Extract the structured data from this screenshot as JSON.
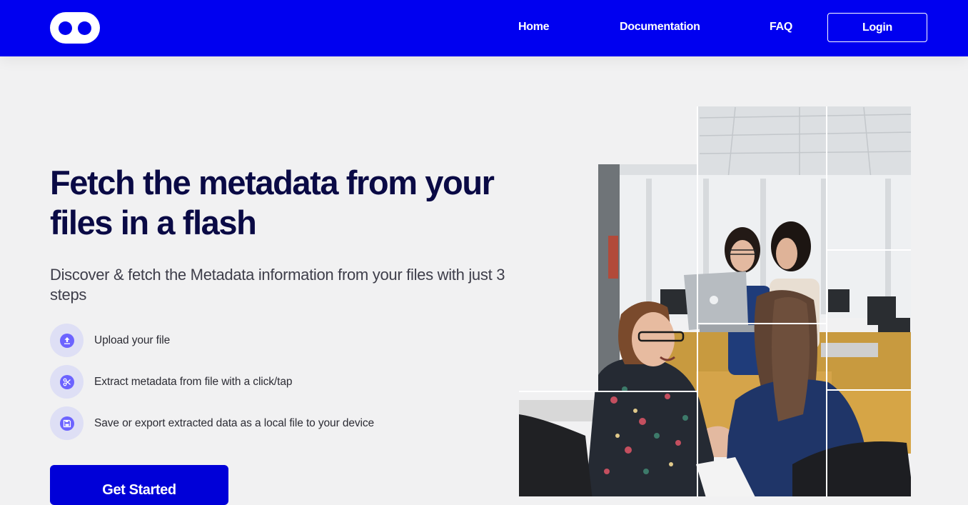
{
  "nav": {
    "logo_icon": "eyes-logo-icon",
    "links": [
      "Home",
      "Documentation",
      "FAQ"
    ],
    "login_label": "Login"
  },
  "hero": {
    "title": "Fetch the metadata from your files in a flash",
    "subtitle": "Discover & fetch the Metadata information from your files with just 3 steps",
    "steps": [
      {
        "icon": "upload-icon",
        "label": "Upload your file"
      },
      {
        "icon": "scissors-icon",
        "label": "Extract metadata from file with a click/tap"
      },
      {
        "icon": "save-icon",
        "label": "Save or export extracted data as a local file to your device"
      }
    ],
    "cta_label": "Get Started"
  },
  "image": {
    "name": "office-team-photo-collage"
  },
  "colors": {
    "brand_blue": "#0000f0",
    "title_navy": "#0a0a45",
    "icon_purple": "#6c63ff",
    "background": "#f1f1f2"
  }
}
